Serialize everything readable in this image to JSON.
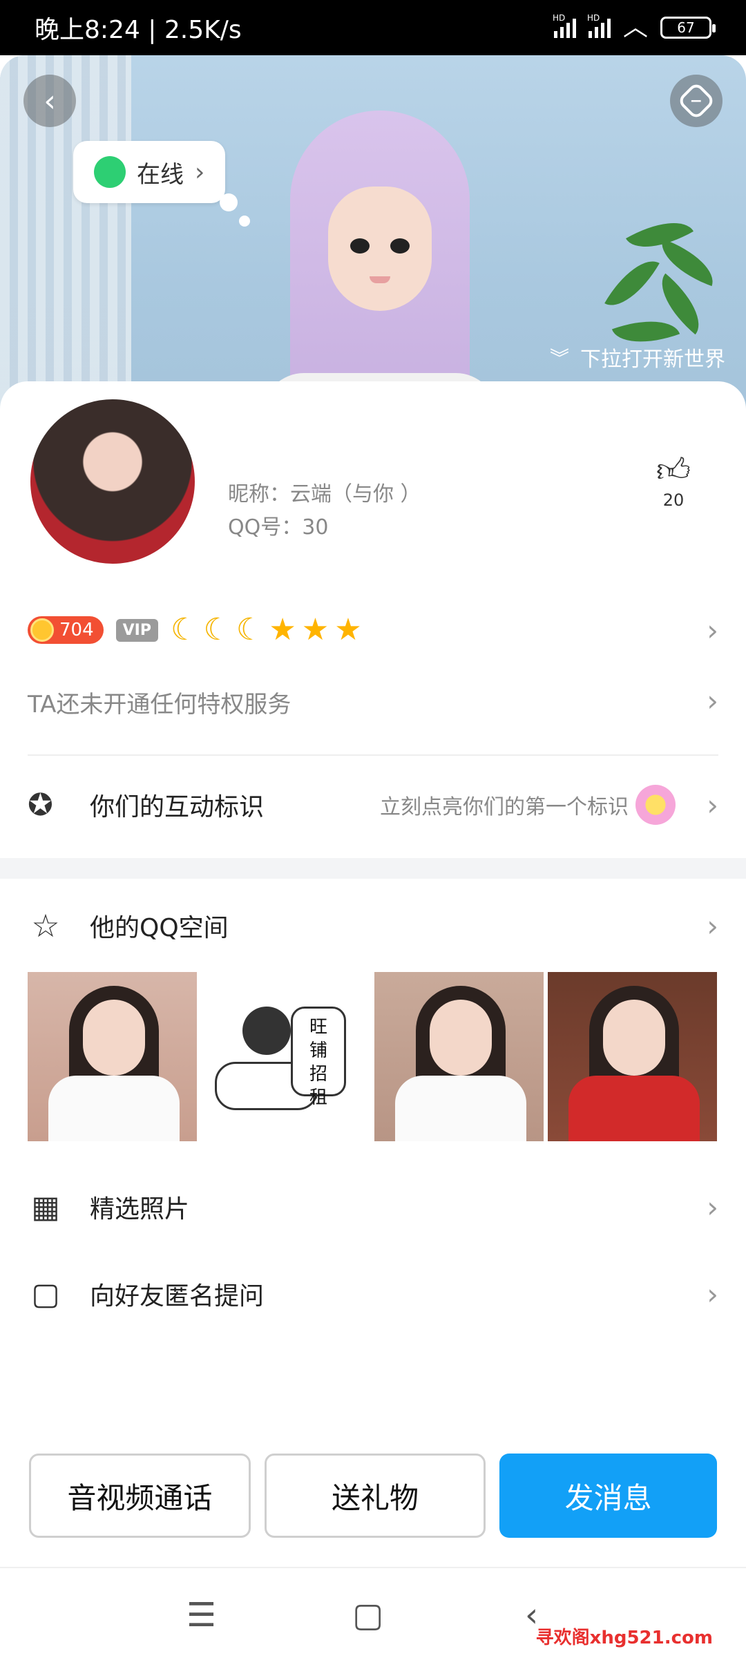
{
  "status": {
    "time": "晚上8:24 | 2.5K/s",
    "sim1": "HD",
    "sim2": "HD",
    "battery": "67"
  },
  "hero": {
    "online_label": "在线",
    "pull_hint": "下拉打开新世界"
  },
  "profile": {
    "nickname": "昵称：云端（与你          ）",
    "qq": "QQ号：30",
    "likes": "20"
  },
  "level": {
    "coins": "704",
    "vip": "VIP",
    "badges": [
      "moon",
      "moon",
      "moon",
      "star",
      "star",
      "star"
    ]
  },
  "privilege": {
    "text": "TA还未开通任何特权服务"
  },
  "interaction": {
    "label": "你们的互动标识",
    "hint": "立刻点亮你们的第一个标识"
  },
  "qzone": {
    "label": "他的QQ空间",
    "sticker_text": "旺\n铺\n招\n租"
  },
  "menu": {
    "featured_photos": "精选照片",
    "anon_question": "向好友匿名提问"
  },
  "actions": {
    "call": "音视频通话",
    "gift": "送礼物",
    "message": "发消息"
  },
  "watermark": "寻欢阁xhg521.com"
}
